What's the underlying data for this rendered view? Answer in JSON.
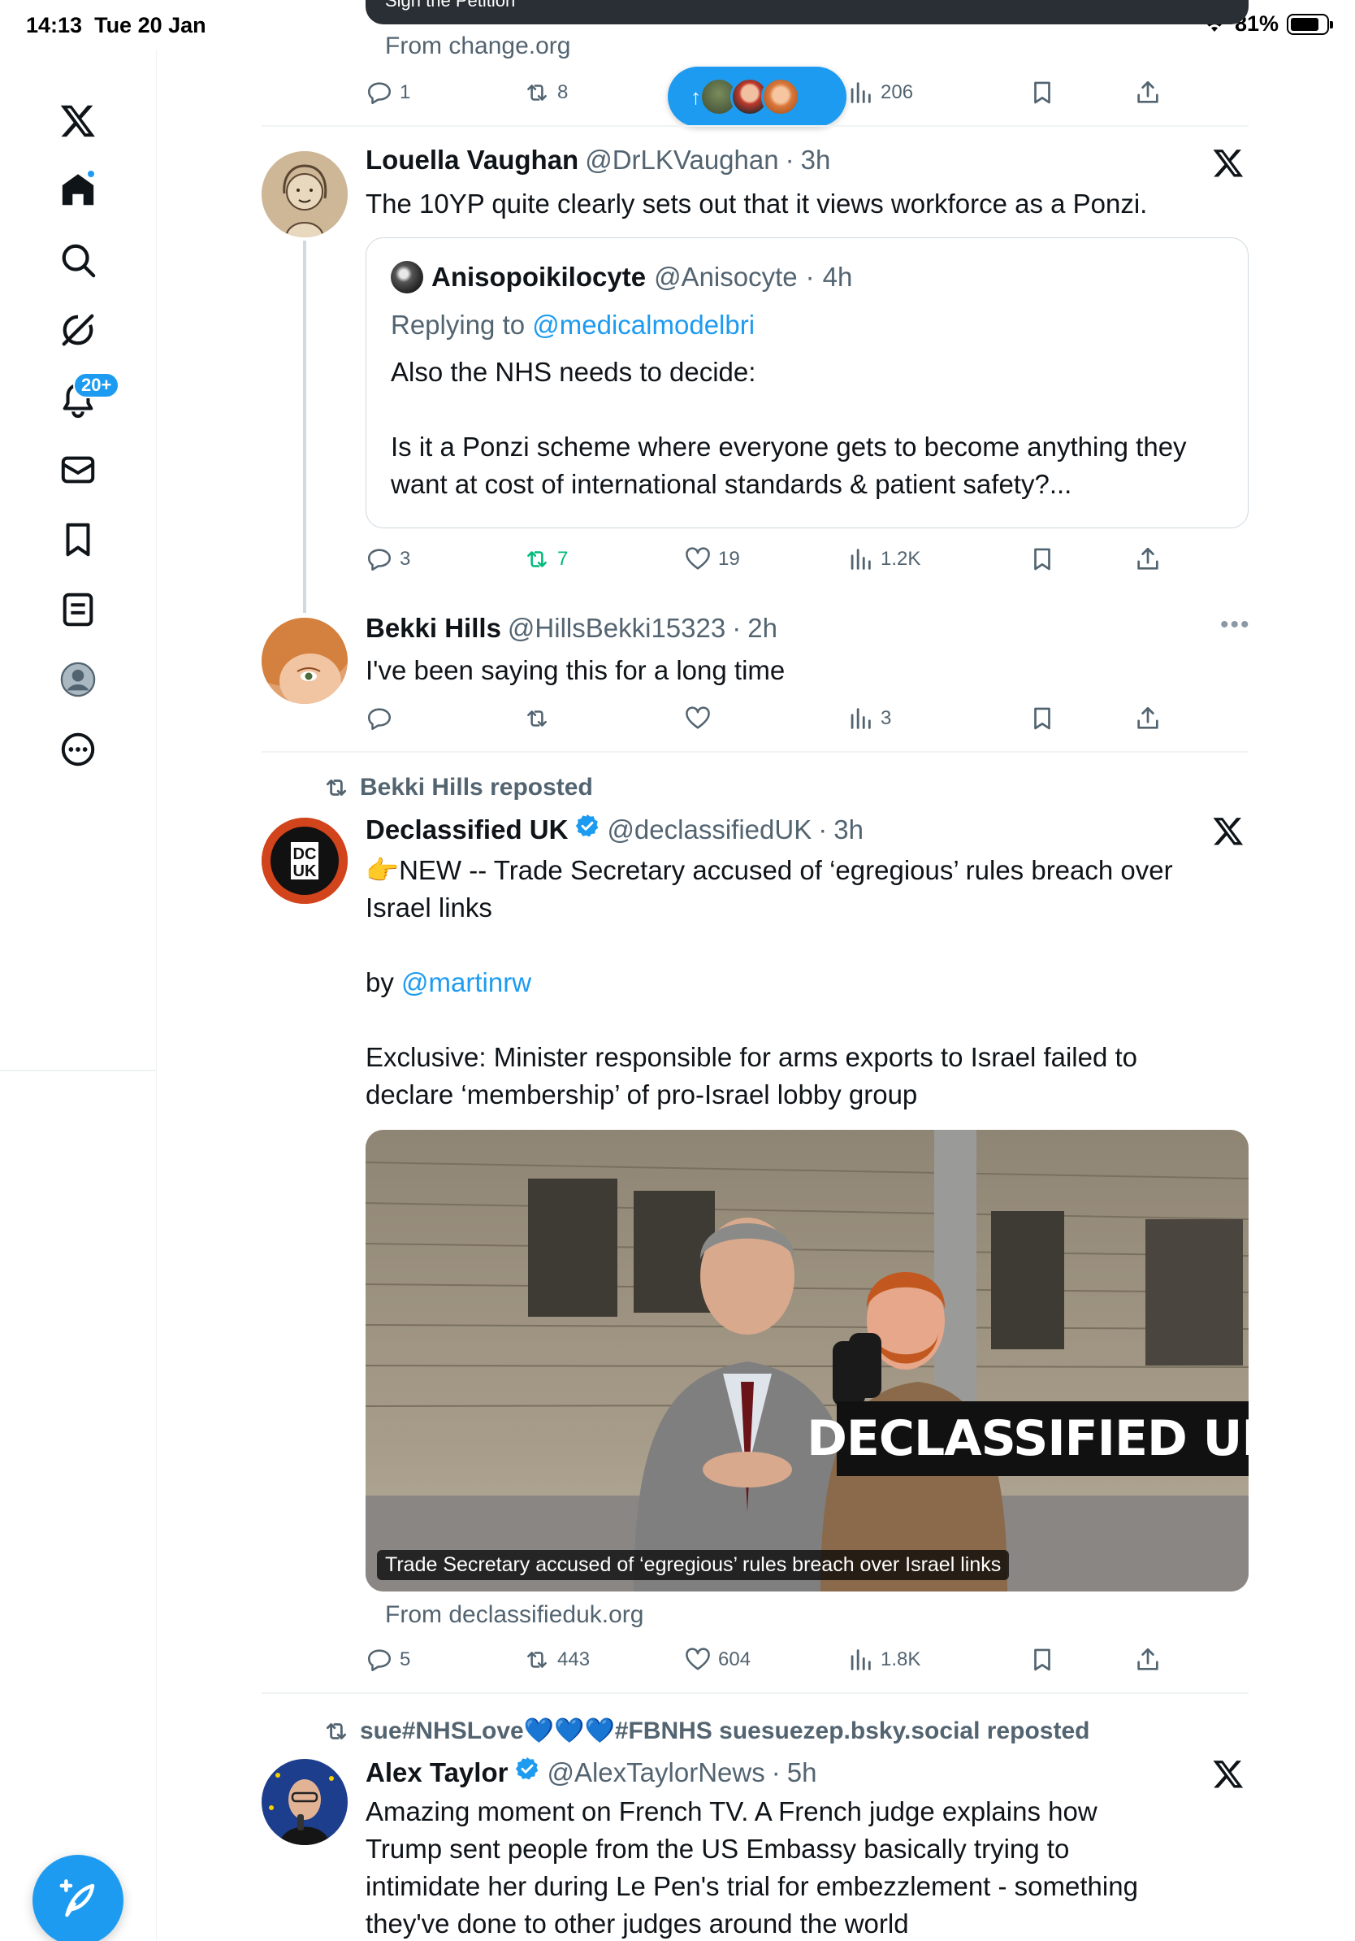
{
  "status_bar": {
    "time": "14:13",
    "date": "Tue 20 Jan",
    "battery": "81%",
    "battery_level": 0.81
  },
  "sidebar": {
    "items": [
      {
        "name": "X",
        "icon": "x-logo-icon"
      },
      {
        "name": "Home",
        "icon": "home-icon"
      },
      {
        "name": "Explore",
        "icon": "search-icon"
      },
      {
        "name": "Grok",
        "icon": "grok-icon"
      },
      {
        "name": "Notifications",
        "icon": "bell-icon",
        "badge": "20+"
      },
      {
        "name": "Messages",
        "icon": "envelope-icon"
      },
      {
        "name": "Bookmarks",
        "icon": "bookmark-icon"
      },
      {
        "name": "Lists",
        "icon": "list-icon"
      },
      {
        "name": "Profile",
        "icon": "profile-icon"
      },
      {
        "name": "More",
        "icon": "more-icon"
      }
    ],
    "compose": {
      "icon": "compose-feather-icon"
    }
  },
  "feed": {
    "accent": "#1d9bf0",
    "top_card": {
      "button_label": "Sign the Petition",
      "source": "From change.org",
      "actions": {
        "replies": "1",
        "reposts": "8",
        "views": "206"
      }
    },
    "new_posts_pill": {
      "icon": "arrow-up-icon"
    },
    "posts": [
      {
        "name": "Louella Vaughan",
        "handle": "@DrLKVaughan",
        "time": "3h",
        "text": "The 10YP quite clearly sets out that it views workforce as a Ponzi.",
        "quote": {
          "name": "Anisopoikilocyte",
          "handle": "@Anisocyte",
          "time": "4h",
          "replying_prefix": "Replying to",
          "replying_to": "@medicalmodelbri",
          "line1": "Also the NHS needs to decide:",
          "line2": "Is it a Ponzi scheme where everyone gets to become anything they want at cost of international standards & patient safety?..."
        },
        "actions": {
          "replies": "3",
          "reposts": "7",
          "likes": "19",
          "views": "1.2K"
        }
      },
      {
        "name": "Bekki Hills",
        "handle": "@HillsBekki15323",
        "time": "2h",
        "text": "I've been saying this for a long time",
        "actions": {
          "views": "3"
        }
      },
      {
        "repost_label": "Bekki Hills reposted",
        "name": "Declassified UK",
        "handle": "@declassifiedUK",
        "time": "3h",
        "verified": true,
        "line1": "👉NEW -- Trade Secretary accused of ‘egregious’ rules breach over Israel links",
        "by_prefix": "by",
        "by_link": "@martinrw",
        "line3": "Exclusive: Minister responsible for arms exports to Israel failed to declare ‘membership’ of pro-Israel lobby group",
        "media_caption": "Trade Secretary accused of ‘egregious’ rules breach over Israel links",
        "media_brand": "DECLASSIFIED UK",
        "avatar_text_top": "DC",
        "avatar_text_bottom": "UK",
        "source": "From declassifieduk.org",
        "actions": {
          "replies": "5",
          "reposts": "443",
          "likes": "604",
          "views": "1.8K"
        }
      },
      {
        "repost_label": "sue#NHSLove💙💙💙#FBNHS suesuezep.bsky.social reposted",
        "name": "Alex Taylor",
        "handle": "@AlexTaylorNews",
        "time": "5h",
        "verified": true,
        "text": "Amazing moment on French TV. A French judge explains how Trump sent people from the US Embassy basically trying to intimidate her during Le Pen's trial for embezzlement - something they've done to other judges around the world"
      }
    ]
  }
}
